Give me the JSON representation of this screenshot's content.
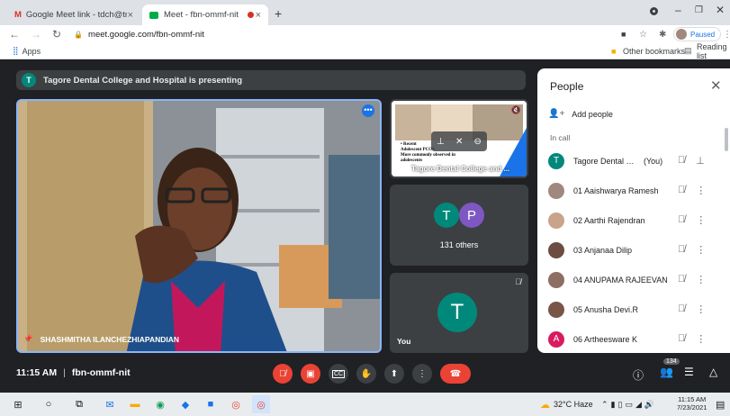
{
  "tabs": [
    {
      "title": "Google Meet link - tdch@tnchá",
      "close": "×"
    },
    {
      "title": "Meet - fbn-ommf-nit",
      "close": "×"
    }
  ],
  "new_tab": "+",
  "url": "meet.google.com/fbn-ommf-nit",
  "profile_status": "Paused",
  "bookmarks": {
    "apps": "Apps",
    "other": "Other bookmarks",
    "reading": "Reading list"
  },
  "banner": {
    "initial": "T",
    "text": "Tagore Dental College and Hospital is presenting"
  },
  "main_video": {
    "name": "SHASHMITHA ILANCHEZHIAPANDIAN"
  },
  "presentation": {
    "label": "Tagore Dental College and ...",
    "slide_lines": [
      "• Recent",
      "Adolescent PCOS",
      "More commonly observed in",
      "adolescents"
    ]
  },
  "others_tile": {
    "initials": [
      "T",
      "P"
    ],
    "colors": [
      "#00897b",
      "#7e57c2"
    ],
    "label": "131 others"
  },
  "you_tile": {
    "initial": "T",
    "label": "You"
  },
  "people": {
    "title": "People",
    "add": "Add people",
    "section": "In call",
    "items": [
      {
        "name": "Tagore Dental Colle...",
        "suffix": "(You)",
        "initial": "T",
        "color": "#00897b"
      },
      {
        "name": "01 Aaishwarya Ramesh",
        "color": "#a1887f"
      },
      {
        "name": "02 Aarthi Rajendran",
        "color": "#c9a38a"
      },
      {
        "name": "03 Anjanaa Dilip",
        "color": "#6d4c41"
      },
      {
        "name": "04 ANUPAMA RAJEEVAN",
        "color": "#8d6e63"
      },
      {
        "name": "05 Anusha Devi.R",
        "color": "#795548"
      },
      {
        "name": "06 Artheesware K",
        "initial": "A",
        "color": "#d81b60"
      }
    ]
  },
  "bottom": {
    "time": "11:15 AM",
    "meeting_code": "fbn-ommf-nit",
    "people_count": "134"
  },
  "taskbar": {
    "weather": "32°C Haze",
    "time": "11:15 AM",
    "date": "7/23/2021"
  }
}
